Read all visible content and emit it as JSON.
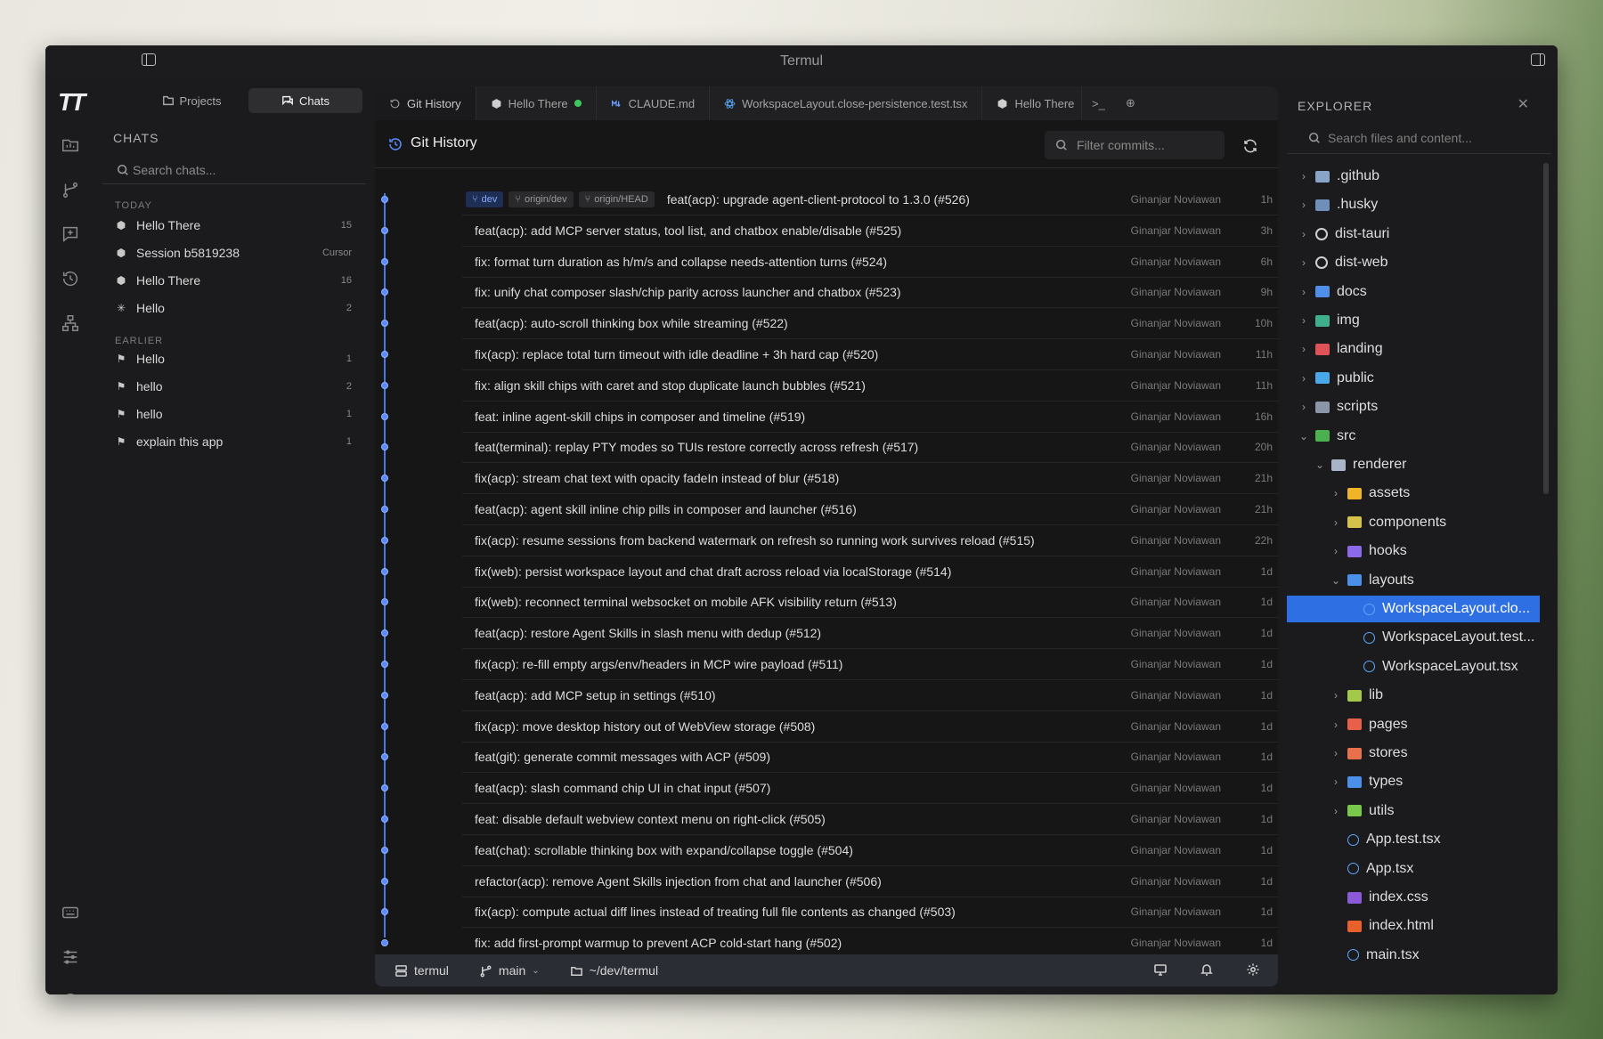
{
  "window": {
    "title": "Termul"
  },
  "nav": {
    "segments": [
      {
        "label": "Projects"
      },
      {
        "label": "Chats"
      }
    ]
  },
  "chats": {
    "header": "CHATS",
    "search_placeholder": "Search chats...",
    "today_label": "TODAY",
    "earlier_label": "EARLIER",
    "today": [
      {
        "title": "Hello There",
        "meta": "15"
      },
      {
        "title": "Session b5819238",
        "meta": "Cursor"
      },
      {
        "title": "Hello There",
        "meta": "16"
      },
      {
        "title": "Hello",
        "meta": "2"
      }
    ],
    "earlier": [
      {
        "title": "Hello",
        "meta": "1"
      },
      {
        "title": "hello",
        "meta": "2"
      },
      {
        "title": "hello",
        "meta": "1"
      },
      {
        "title": "explain this app",
        "meta": "1"
      }
    ]
  },
  "tabs": [
    {
      "label": "Git History",
      "icon": "history-icon",
      "active": true
    },
    {
      "label": "Hello There",
      "icon": "agent-icon",
      "dot": true
    },
    {
      "label": "CLAUDE.md",
      "icon": "markdown-icon"
    },
    {
      "label": "WorkspaceLayout.close-persistence.test.tsx",
      "icon": "react-icon"
    },
    {
      "label": "Hello There",
      "icon": "agent-icon",
      "dot": true
    }
  ],
  "tab_extras": [
    {
      "symbol": ">_"
    },
    {
      "symbol": "⊕"
    }
  ],
  "git_history": {
    "title": "Git History",
    "filter_placeholder": "Filter commits...",
    "refs": [
      "dev",
      "origin/dev",
      "origin/HEAD"
    ],
    "commits": [
      {
        "message": "feat(acp): upgrade agent-client-protocol to 1.3.0 (#526)",
        "author": "Ginanjar Noviawan",
        "time": "1h"
      },
      {
        "message": "feat(acp): add MCP server status, tool list, and chatbox enable/disable (#525)",
        "author": "Ginanjar Noviawan",
        "time": "3h"
      },
      {
        "message": "fix: format turn duration as h/m/s and collapse needs-attention turns (#524)",
        "author": "Ginanjar Noviawan",
        "time": "6h"
      },
      {
        "message": "fix: unify chat composer slash/chip parity across launcher and chatbox (#523)",
        "author": "Ginanjar Noviawan",
        "time": "9h"
      },
      {
        "message": "feat(acp): auto-scroll thinking box while streaming (#522)",
        "author": "Ginanjar Noviawan",
        "time": "10h"
      },
      {
        "message": "fix(acp): replace total turn timeout with idle deadline + 3h hard cap (#520)",
        "author": "Ginanjar Noviawan",
        "time": "11h"
      },
      {
        "message": "fix: align skill chips with caret and stop duplicate launch bubbles (#521)",
        "author": "Ginanjar Noviawan",
        "time": "11h"
      },
      {
        "message": "feat: inline agent-skill chips in composer and timeline (#519)",
        "author": "Ginanjar Noviawan",
        "time": "16h"
      },
      {
        "message": "feat(terminal): replay PTY modes so TUIs restore correctly across refresh (#517)",
        "author": "Ginanjar Noviawan",
        "time": "20h"
      },
      {
        "message": "fix(acp): stream chat text with opacity fadeIn instead of blur (#518)",
        "author": "Ginanjar Noviawan",
        "time": "21h"
      },
      {
        "message": "feat(acp): agent skill inline chip pills in composer and launcher (#516)",
        "author": "Ginanjar Noviawan",
        "time": "21h"
      },
      {
        "message": "fix(acp): resume sessions from backend watermark on refresh so running work survives reload (#515)",
        "author": "Ginanjar Noviawan",
        "time": "22h"
      },
      {
        "message": "fix(web): persist workspace layout and chat draft across reload via localStorage (#514)",
        "author": "Ginanjar Noviawan",
        "time": "1d"
      },
      {
        "message": "fix(web): reconnect terminal websocket on mobile AFK visibility return (#513)",
        "author": "Ginanjar Noviawan",
        "time": "1d"
      },
      {
        "message": "feat(acp): restore Agent Skills in slash menu with dedup (#512)",
        "author": "Ginanjar Noviawan",
        "time": "1d"
      },
      {
        "message": "fix(acp): re-fill empty args/env/headers in MCP wire payload (#511)",
        "author": "Ginanjar Noviawan",
        "time": "1d"
      },
      {
        "message": "feat(acp): add MCP setup in settings (#510)",
        "author": "Ginanjar Noviawan",
        "time": "1d"
      },
      {
        "message": "fix(acp): move desktop history out of WebView storage (#508)",
        "author": "Ginanjar Noviawan",
        "time": "1d"
      },
      {
        "message": "feat(git): generate commit messages with ACP (#509)",
        "author": "Ginanjar Noviawan",
        "time": "1d"
      },
      {
        "message": "feat(acp): slash command chip UI in chat input (#507)",
        "author": "Ginanjar Noviawan",
        "time": "1d"
      },
      {
        "message": "feat: disable default webview context menu on right-click (#505)",
        "author": "Ginanjar Noviawan",
        "time": "1d"
      },
      {
        "message": "feat(chat): scrollable thinking box with expand/collapse toggle (#504)",
        "author": "Ginanjar Noviawan",
        "time": "1d"
      },
      {
        "message": "refactor(acp): remove Agent Skills injection from chat and launcher (#506)",
        "author": "Ginanjar Noviawan",
        "time": "1d"
      },
      {
        "message": "fix(acp): compute actual diff lines instead of treating full file contents as changed (#503)",
        "author": "Ginanjar Noviawan",
        "time": "1d"
      },
      {
        "message": "fix: add first-prompt warmup to prevent ACP cold-start hang (#502)",
        "author": "Ginanjar Noviawan",
        "time": "1d"
      }
    ]
  },
  "statusbar": {
    "project": "termul",
    "branch": "main",
    "path": "~/dev/termul"
  },
  "explorer": {
    "header": "EXPLORER",
    "search_placeholder": "Search files and content...",
    "tree": [
      {
        "name": ".github",
        "depth": 0,
        "chev": "›",
        "color": "#8aa4c8"
      },
      {
        "name": ".husky",
        "depth": 0,
        "chev": "›",
        "color": "#6f8fb8"
      },
      {
        "name": "dist-tauri",
        "depth": 0,
        "chev": "›",
        "color": "#cfcfcf",
        "round": true
      },
      {
        "name": "dist-web",
        "depth": 0,
        "chev": "›",
        "color": "#cfcfcf",
        "round": true
      },
      {
        "name": "docs",
        "depth": 0,
        "chev": "›",
        "color": "#4f8fe8"
      },
      {
        "name": "img",
        "depth": 0,
        "chev": "›",
        "color": "#3fae8c"
      },
      {
        "name": "landing",
        "depth": 0,
        "chev": "›",
        "color": "#e0525a"
      },
      {
        "name": "public",
        "depth": 0,
        "chev": "›",
        "color": "#4aa8e8"
      },
      {
        "name": "scripts",
        "depth": 0,
        "chev": "›",
        "color": "#8a96a8"
      },
      {
        "name": "src",
        "depth": 0,
        "chev": "⌄",
        "color": "#4caf50"
      },
      {
        "name": "renderer",
        "depth": 1,
        "chev": "⌄",
        "color": "#a8b4c8"
      },
      {
        "name": "assets",
        "depth": 2,
        "chev": "›",
        "color": "#f0b429"
      },
      {
        "name": "components",
        "depth": 2,
        "chev": "›",
        "color": "#d4c24a"
      },
      {
        "name": "hooks",
        "depth": 2,
        "chev": "›",
        "color": "#8a6ae8"
      },
      {
        "name": "layouts",
        "depth": 2,
        "chev": "⌄",
        "color": "#4a90e8"
      },
      {
        "name": "WorkspaceLayout.clo...",
        "depth": 3,
        "chev": "",
        "color": "#5aa8ff",
        "react": true,
        "selected": true
      },
      {
        "name": "WorkspaceLayout.test...",
        "depth": 3,
        "chev": "",
        "color": "#5aa8ff",
        "react": true
      },
      {
        "name": "WorkspaceLayout.tsx",
        "depth": 3,
        "chev": "",
        "color": "#5aa8ff",
        "react": true
      },
      {
        "name": "lib",
        "depth": 2,
        "chev": "›",
        "color": "#a4c84a"
      },
      {
        "name": "pages",
        "depth": 2,
        "chev": "›",
        "color": "#e8604a"
      },
      {
        "name": "stores",
        "depth": 2,
        "chev": "›",
        "color": "#e8704a"
      },
      {
        "name": "types",
        "depth": 2,
        "chev": "›",
        "color": "#4a90e8"
      },
      {
        "name": "utils",
        "depth": 2,
        "chev": "›",
        "color": "#7ac84a"
      },
      {
        "name": "App.test.tsx",
        "depth": 2,
        "chev": "",
        "color": "#5aa8ff",
        "react": true
      },
      {
        "name": "App.tsx",
        "depth": 2,
        "chev": "",
        "color": "#5aa8ff",
        "react": true
      },
      {
        "name": "index.css",
        "depth": 2,
        "chev": "",
        "color": "#8a5ad8"
      },
      {
        "name": "index.html",
        "depth": 2,
        "chev": "",
        "color": "#e8602a"
      },
      {
        "name": "main.tsx",
        "depth": 2,
        "chev": "",
        "color": "#5aa8ff",
        "react": true
      }
    ]
  },
  "colors": {
    "accent": "#2f6fe4",
    "graph": "#4a78e8",
    "online": "#3cc85c"
  }
}
